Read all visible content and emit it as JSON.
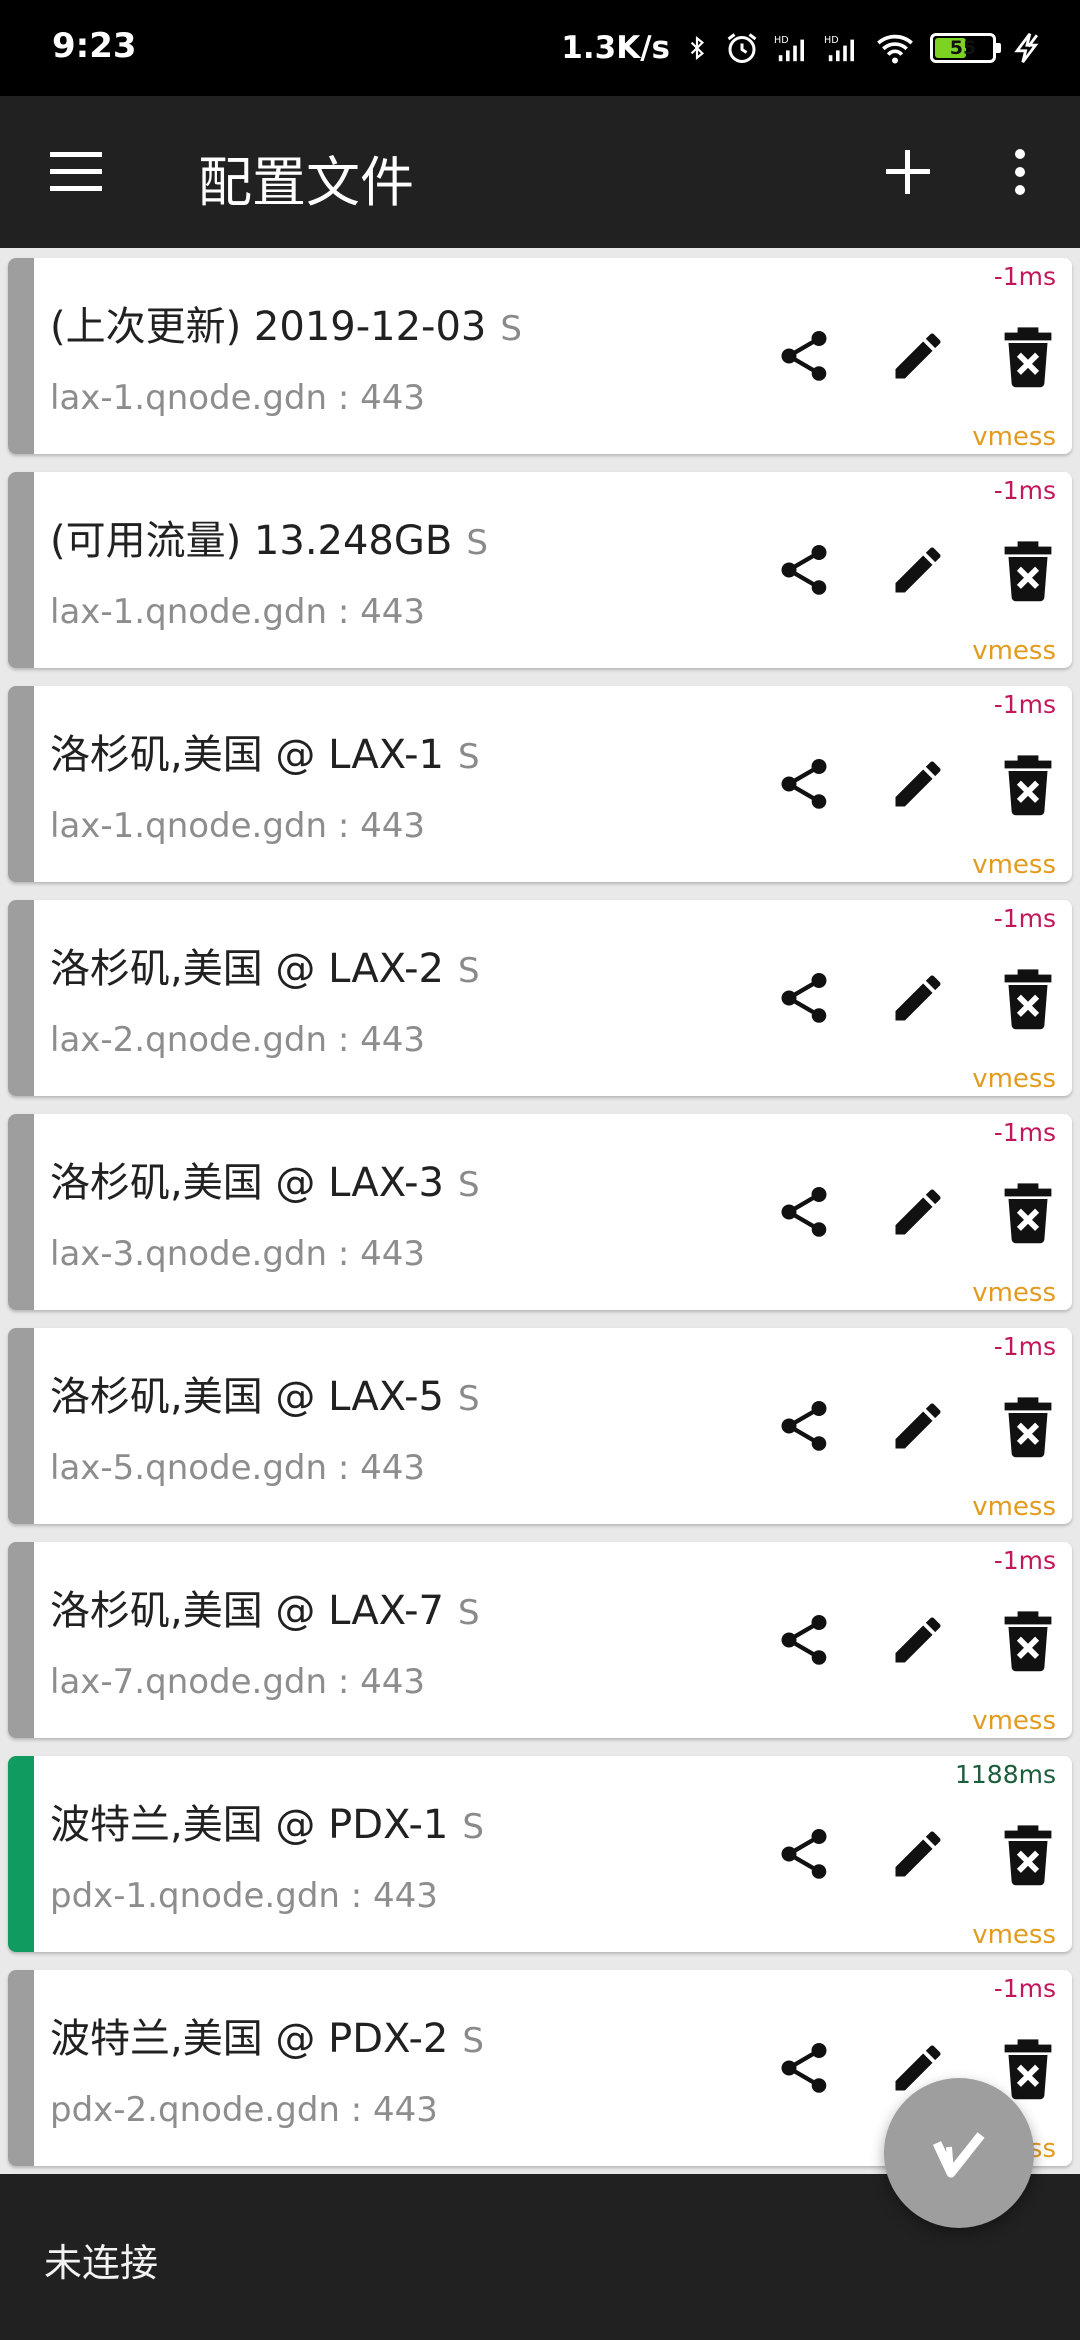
{
  "status_bar": {
    "time": "9:23",
    "net_speed": "1.3K/s",
    "battery_level": "55",
    "battery_fraction": 0.55,
    "icons": [
      "bluetooth-icon",
      "alarm-icon",
      "hd-signal-icon",
      "hd-signal-icon",
      "wifi-icon",
      "battery-icon",
      "charging-icon"
    ]
  },
  "app_bar": {
    "title": "配置文件",
    "icons": [
      "menu-icon",
      "add-icon",
      "more-vert-icon"
    ]
  },
  "servers": [
    {
      "name": "(上次更新) 2019-12-03",
      "type": "S",
      "address": "lax-1.qnode.gdn : 443",
      "latency": "-1ms",
      "protocol": "vmess",
      "active": false
    },
    {
      "name": "(可用流量) 13.248GB",
      "type": "S",
      "address": "lax-1.qnode.gdn : 443",
      "latency": "-1ms",
      "protocol": "vmess",
      "active": false
    },
    {
      "name": "洛杉矶,美国 @ LAX-1",
      "type": "S",
      "address": "lax-1.qnode.gdn : 443",
      "latency": "-1ms",
      "protocol": "vmess",
      "active": false
    },
    {
      "name": "洛杉矶,美国 @ LAX-2",
      "type": "S",
      "address": "lax-2.qnode.gdn : 443",
      "latency": "-1ms",
      "protocol": "vmess",
      "active": false
    },
    {
      "name": "洛杉矶,美国 @ LAX-3",
      "type": "S",
      "address": "lax-3.qnode.gdn : 443",
      "latency": "-1ms",
      "protocol": "vmess",
      "active": false
    },
    {
      "name": "洛杉矶,美国 @ LAX-5",
      "type": "S",
      "address": "lax-5.qnode.gdn : 443",
      "latency": "-1ms",
      "protocol": "vmess",
      "active": false
    },
    {
      "name": "洛杉矶,美国 @ LAX-7",
      "type": "S",
      "address": "lax-7.qnode.gdn : 443",
      "latency": "-1ms",
      "protocol": "vmess",
      "active": false
    },
    {
      "name": "波特兰,美国 @ PDX-1",
      "type": "S",
      "address": "pdx-1.qnode.gdn : 443",
      "latency": "1188ms",
      "protocol": "vmess",
      "active": true
    },
    {
      "name": "波特兰,美国 @ PDX-2",
      "type": "S",
      "address": "pdx-2.qnode.gdn : 443",
      "latency": "-1ms",
      "protocol": "vmess",
      "active": false
    }
  ],
  "bottom_bar": {
    "connection_status": "未连接"
  },
  "fab": {
    "icon": "v-logo-icon"
  },
  "colors": {
    "app_bar": "#212121",
    "active_indicator": "#109b60",
    "inactive_indicator": "#9e9e9e",
    "latency_fail": "#c2185b",
    "latency_ok": "#1b5e3c",
    "protocol": "#e39b1f"
  }
}
